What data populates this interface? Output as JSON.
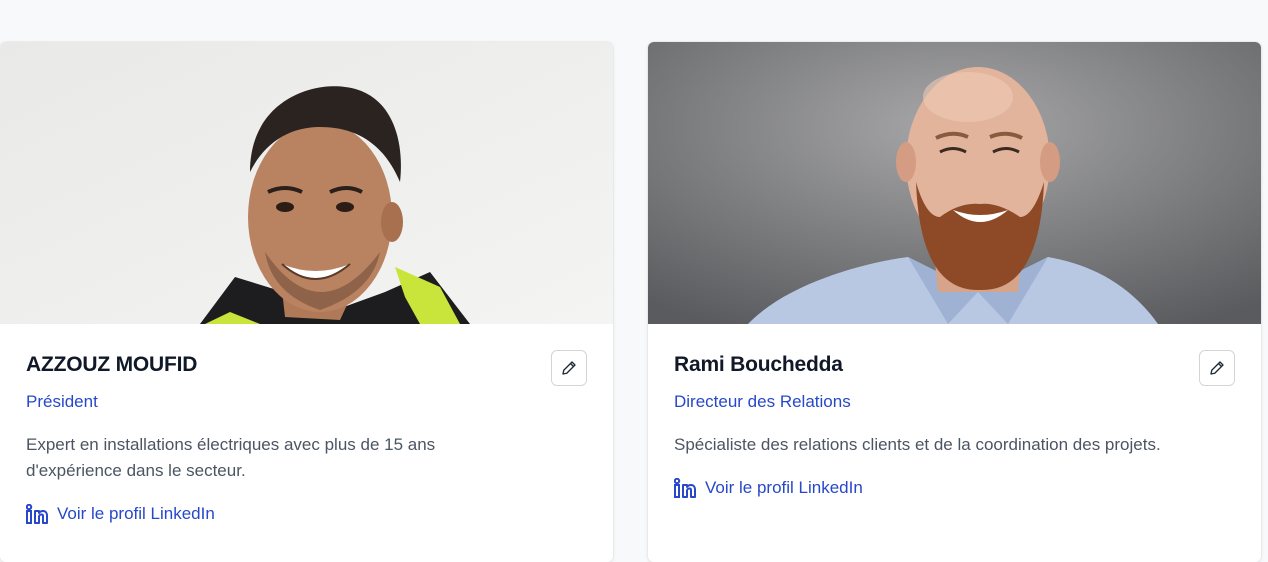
{
  "members": [
    {
      "name": "AZZOUZ MOUFID",
      "role": "Président",
      "bio": "Expert en installations électriques avec plus de 15 ans d'expérience dans le secteur.",
      "linkedin_label": "Voir le profil LinkedIn",
      "photo_alt": "AZZOUZ MOUFID"
    },
    {
      "name": "Rami Bouchedda",
      "role": "Directeur des Relations",
      "bio": "Spécialiste des relations clients et de la coordination des projets.",
      "linkedin_label": "Voir le profil LinkedIn",
      "photo_alt": "Rami Bouchedda"
    }
  ],
  "icons": {
    "edit": "pencil-icon",
    "linkedin": "linkedin-icon"
  },
  "colors": {
    "accent": "#2748c9",
    "name": "#111827",
    "text": "#4b5563",
    "background": "#f8f9fb"
  }
}
